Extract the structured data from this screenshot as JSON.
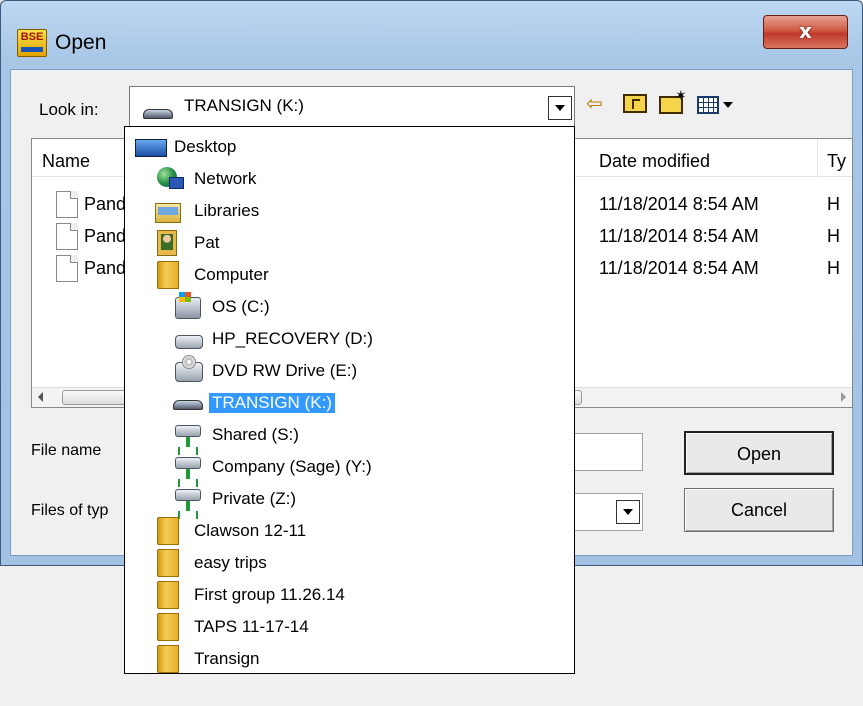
{
  "window": {
    "title": "Open",
    "close_label": "x",
    "app_icon_label": "BSE"
  },
  "toolbar": {
    "lookin_label": "Look in:",
    "lookin_value": "TRANSIGN (K:)",
    "icons": [
      "back-arrow-icon",
      "up-folder-icon",
      "new-folder-icon",
      "views-menu-icon"
    ]
  },
  "filelist": {
    "columns": [
      "Name",
      "Date modified",
      "Ty"
    ],
    "rows": [
      {
        "name": "Pand",
        "date": "11/18/2014 8:54 AM",
        "type": "H"
      },
      {
        "name": "Pand",
        "date": "11/18/2014 8:54 AM",
        "type": "H"
      },
      {
        "name": "Pand",
        "date": "11/18/2014 8:54 AM",
        "type": "H"
      }
    ]
  },
  "form": {
    "filename_label": "File name",
    "filename_value": "",
    "filetype_label": "Files of typ",
    "filetype_value": "",
    "open_label": "Open",
    "cancel_label": "Cancel"
  },
  "dropdown": {
    "items": [
      {
        "label": "Desktop",
        "icon": "desktop-icon",
        "selected": false
      },
      {
        "label": "Network",
        "icon": "network-icon",
        "selected": false
      },
      {
        "label": "Libraries",
        "icon": "libraries-icon",
        "selected": false
      },
      {
        "label": "Pat",
        "icon": "user-folder-icon",
        "selected": false
      },
      {
        "label": "Computer",
        "icon": "folder-icon",
        "selected": false
      },
      {
        "label": "OS (C:)",
        "icon": "os-drive-icon",
        "selected": false
      },
      {
        "label": "HP_RECOVERY (D:)",
        "icon": "hard-drive-icon",
        "selected": false
      },
      {
        "label": "DVD RW Drive (E:)",
        "icon": "dvd-drive-icon",
        "selected": false
      },
      {
        "label": "TRANSIGN (K:)",
        "icon": "usb-drive-icon",
        "selected": true
      },
      {
        "label": "Shared (S:)",
        "icon": "network-drive-icon",
        "selected": false
      },
      {
        "label": "Company (Sage) (Y:)",
        "icon": "network-drive-icon",
        "selected": false
      },
      {
        "label": "Private (Z:)",
        "icon": "network-drive-icon",
        "selected": false
      },
      {
        "label": "Clawson 12-11",
        "icon": "folder-icon",
        "selected": false
      },
      {
        "label": "easy trips",
        "icon": "folder-icon",
        "selected": false
      },
      {
        "label": "First group 11.26.14",
        "icon": "folder-icon",
        "selected": false
      },
      {
        "label": "TAPS 11-17-14",
        "icon": "folder-icon",
        "selected": false
      },
      {
        "label": "Transign",
        "icon": "folder-icon",
        "selected": false
      }
    ]
  },
  "colors": {
    "selection": "#3399ff",
    "title_bar": "#a8c6e6",
    "close_button": "#c0392b"
  }
}
